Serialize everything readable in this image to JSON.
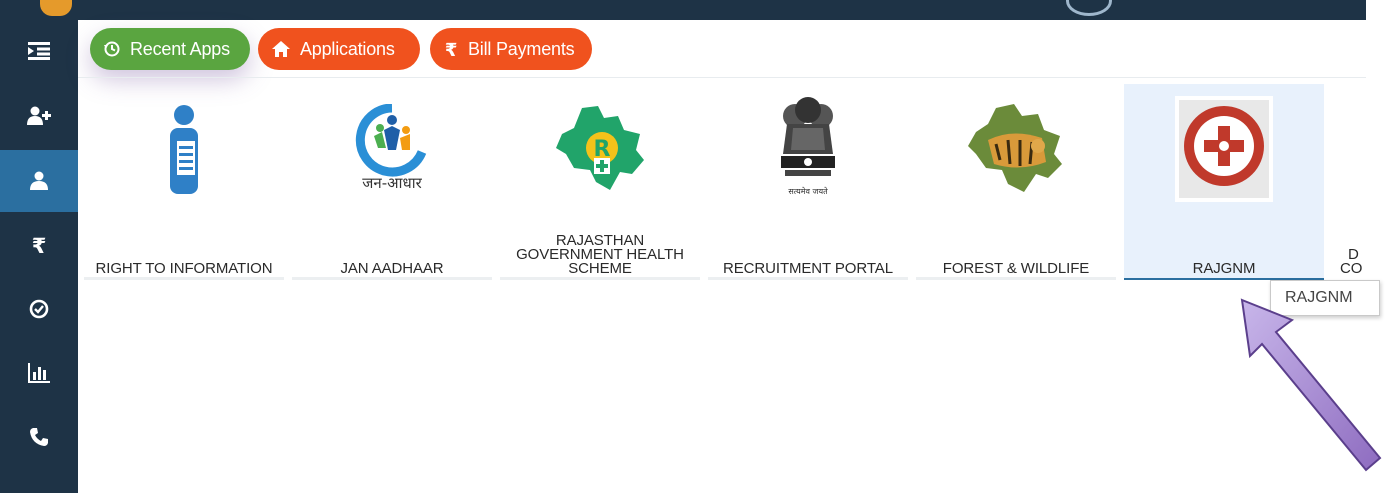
{
  "toolbar": {
    "recent_apps": "Recent Apps",
    "applications": "Applications",
    "bill_payments": "Bill Payments"
  },
  "sidebar": {
    "items": [
      {
        "icon": "menu-indent-icon"
      },
      {
        "icon": "add-user-icon"
      },
      {
        "icon": "user-icon",
        "active": true
      },
      {
        "icon": "rupee-icon"
      },
      {
        "icon": "check-circle-icon"
      },
      {
        "icon": "bar-chart-icon"
      },
      {
        "icon": "phone-icon"
      }
    ]
  },
  "apps": [
    {
      "label": "RIGHT TO INFORMATION",
      "icon": "document-person-icon"
    },
    {
      "label": "JAN AADHAAR",
      "icon": "jan-aadhaar-logo",
      "logo_text": "जन-आधार"
    },
    {
      "label_lines": [
        "RAJASTHAN",
        "GOVERNMENT HEALTH",
        "SCHEME"
      ],
      "icon": "rajasthan-map-icon",
      "logo_letter": "R"
    },
    {
      "label": "RECRUITMENT PORTAL",
      "icon": "ashoka-emblem-icon",
      "logo_text": "सत्यमेव जयते"
    },
    {
      "label": "FOREST & WILDLIFE",
      "icon": "tiger-map-icon"
    },
    {
      "label": "RAJGNM",
      "icon": "rajgnm-seal-icon",
      "selected": true
    },
    {
      "label_lines": [
        "D",
        "CO"
      ],
      "icon": ""
    }
  ],
  "tooltip": {
    "text": "RAJGNM"
  },
  "colors": {
    "sidebar": "#1e3346",
    "sidebar_active": "#2b6fa0",
    "green_pill": "#5aa540",
    "orange_pill": "#f0521e",
    "selected_tile": "#e8f1fc",
    "arrow": "#9b7bc8"
  }
}
